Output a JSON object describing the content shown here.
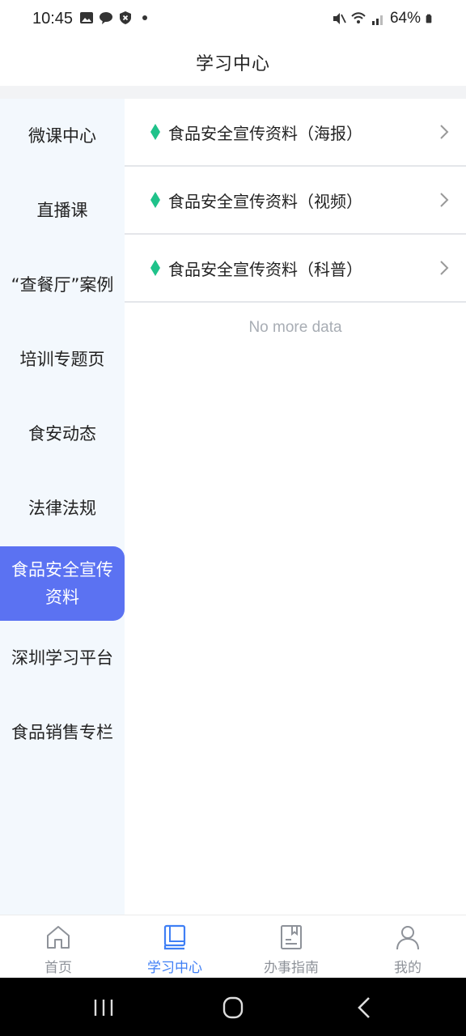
{
  "status_bar": {
    "time": "10:45",
    "battery": "64%"
  },
  "header": {
    "title": "学习中心"
  },
  "sidebar": {
    "items": [
      {
        "label": "微课中心"
      },
      {
        "label": "直播课"
      },
      {
        "label": "“查餐厅”案例"
      },
      {
        "label": "培训专题页"
      },
      {
        "label": "食安动态"
      },
      {
        "label": "法律法规"
      },
      {
        "label": "食品安全宣传资料"
      },
      {
        "label": "深圳学习平台"
      },
      {
        "label": "食品销售专栏"
      }
    ],
    "active_index": 6
  },
  "content": {
    "items": [
      {
        "label": "食品安全宣传资料（海报）"
      },
      {
        "label": "食品安全宣传资料（视频）"
      },
      {
        "label": "食品安全宣传资料（科普）"
      }
    ],
    "empty_text": "No more data"
  },
  "tabbar": {
    "tabs": [
      {
        "label": "首页",
        "icon": "home-icon"
      },
      {
        "label": "学习中心",
        "icon": "book-icon"
      },
      {
        "label": "办事指南",
        "icon": "bookmark-doc-icon"
      },
      {
        "label": "我的",
        "icon": "user-icon"
      }
    ],
    "active_index": 1
  },
  "colors": {
    "accent": "#5b72f2",
    "tab_active": "#3f7ff5",
    "diamond": "#1fc28a"
  }
}
